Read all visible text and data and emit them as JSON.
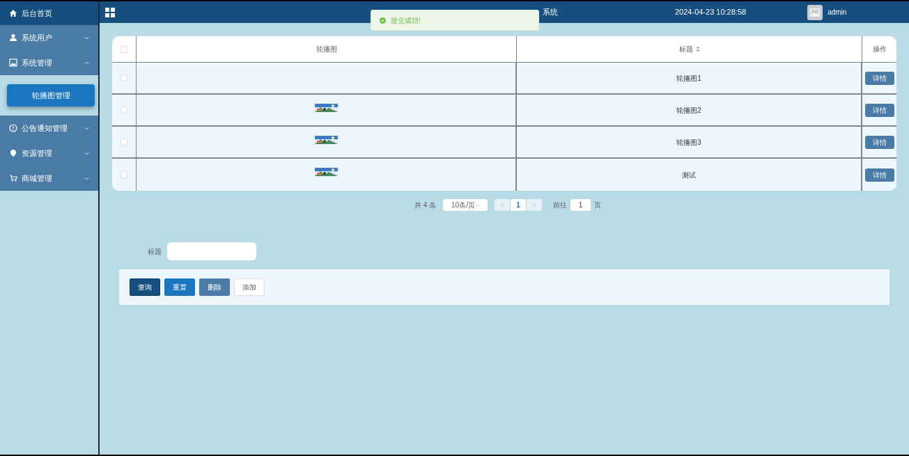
{
  "header": {
    "title": "系统",
    "datetime": "2024-04-23 10:28:58",
    "user": "admin"
  },
  "toast": {
    "message": "提交成功!"
  },
  "sidebar": {
    "items": [
      {
        "label": "后台首页",
        "expanded": false,
        "selected": true
      },
      {
        "label": "系统用户",
        "expanded": false,
        "selected": false
      },
      {
        "label": "系统管理",
        "expanded": true,
        "selected": false,
        "children": [
          {
            "label": "轮播图管理",
            "selected": true
          }
        ]
      },
      {
        "label": "公告通知管理",
        "expanded": false,
        "selected": false
      },
      {
        "label": "资源管理",
        "expanded": false,
        "selected": false
      },
      {
        "label": "商城管理",
        "expanded": false,
        "selected": false
      }
    ]
  },
  "table": {
    "columns": [
      "轮播图",
      "标题",
      "操作"
    ],
    "all_checked": false,
    "rows": [
      {
        "checked": false,
        "image": false,
        "title": "轮播图1",
        "action": "详情"
      },
      {
        "checked": false,
        "image": true,
        "title": "轮播图2",
        "action": "详情"
      },
      {
        "checked": false,
        "image": true,
        "title": "轮播图3",
        "action": "详情"
      },
      {
        "checked": false,
        "image": true,
        "title": "测试",
        "action": "详情"
      }
    ]
  },
  "pagination": {
    "total": "共 4 条",
    "page_size": "10条/页",
    "current_page": "1",
    "goto_label": "前往",
    "goto_value": "1",
    "page_suffix": "页"
  },
  "search": {
    "label": "标题"
  },
  "buttons": [
    {
      "label": "查询",
      "kind": "dark"
    },
    {
      "label": "重置",
      "kind": "primary"
    },
    {
      "label": "删除",
      "kind": "muted"
    },
    {
      "label": "添加",
      "kind": "plain"
    }
  ]
}
